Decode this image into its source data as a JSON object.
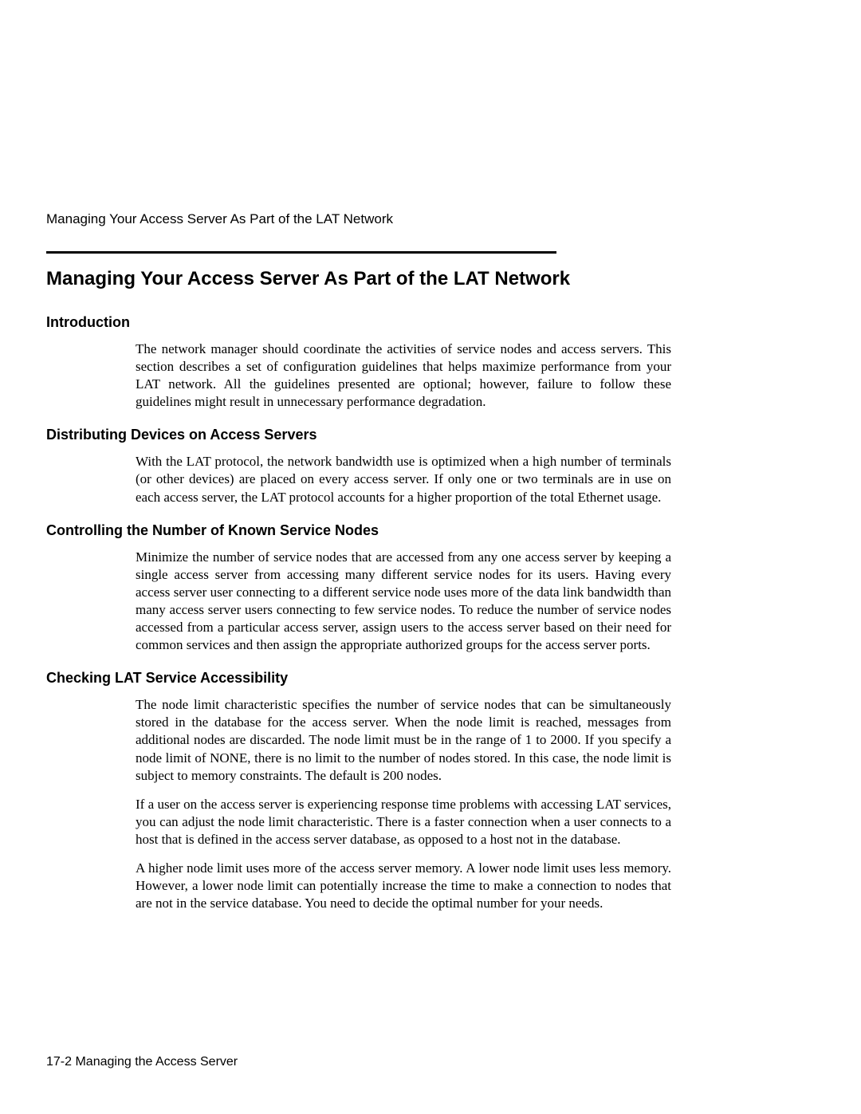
{
  "running_header": "Managing Your Access Server As Part of the LAT Network",
  "main_heading": "Managing Your Access Server As Part of the LAT Network",
  "sections": [
    {
      "heading": "Introduction",
      "paragraphs": [
        "The network manager should coordinate the activities of service nodes and access servers. This section describes a set of configuration guidelines that helps maximize performance from your LAT network. All the guidelines presented are optional; however, failure to follow these guidelines might result in unnecessary performance degradation."
      ]
    },
    {
      "heading": "Distributing Devices on Access Servers",
      "paragraphs": [
        "With the LAT protocol, the network bandwidth use is optimized when a high number of terminals (or other devices) are placed on every access server. If only one or two terminals are in use on each access server, the LAT protocol accounts for a higher proportion of the total Ethernet usage."
      ]
    },
    {
      "heading": "Controlling the Number of Known Service Nodes",
      "paragraphs": [
        "Minimize the number of service nodes that are accessed from any one access server by keeping a single access server from accessing many different service nodes for its users. Having every access server user connecting to a different service node uses more of the data link bandwidth than many access server users connecting to few service nodes. To reduce the number of service nodes accessed from a particular access server, assign users to the access server based on their need for common services and then assign the appropriate authorized groups for the access server ports."
      ]
    },
    {
      "heading": "Checking LAT Service Accessibility",
      "paragraphs": [
        "The node limit characteristic specifies the number of service nodes that can be simultaneously stored in the database for the access server. When the node limit is reached, messages from additional nodes are discarded. The node limit must be in the range of 1 to 2000. If you specify a node limit of NONE, there is no limit to the number of nodes stored. In this case, the node limit is subject to memory constraints. The default is 200 nodes.",
        "If a user on the access server is experiencing response time problems with accessing LAT services, you can adjust the node limit characteristic. There is a faster connection when a user connects to a host that is defined in the access server database, as opposed to a host not in the database.",
        "A higher node limit uses more of the access server memory. A lower node limit uses less memory. However, a lower node limit can potentially increase the time to make a connection to nodes that are not in the service database. You need to decide the optimal number for your needs."
      ]
    }
  ],
  "footer": "17-2  Managing the Access Server"
}
